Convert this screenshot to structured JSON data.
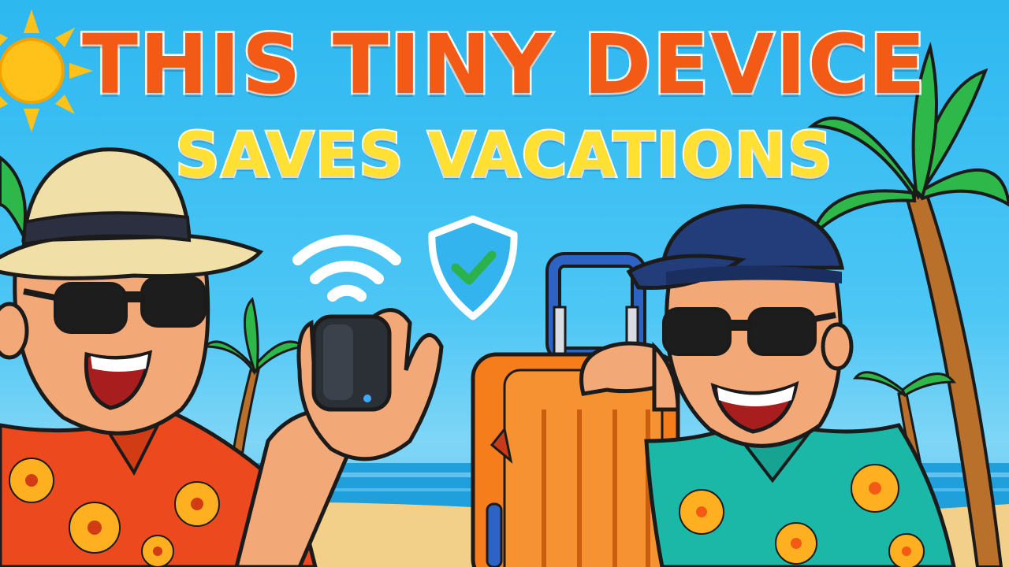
{
  "headline": {
    "line1": "THIS TINY DEVICE",
    "line2": "SAVES VACATIONS"
  },
  "colors": {
    "line1": "#f35a16",
    "line2": "#ffe033",
    "sky": "#2db8f0",
    "sun": "#ffc21a",
    "palm_leaf": "#2fb84a",
    "palm_trunk": "#b8702a",
    "sea": "#1f9fdc",
    "sand": "#f3d08a",
    "skin": "#f2a877",
    "left_shirt": "#ec4a1e",
    "right_shirt": "#1bb8a8",
    "hibiscus": "#ffb020",
    "fedora": "#f1dfa8",
    "cap": "#233d7a",
    "sunglasses": "#1d1d1d",
    "suitcase": "#f57d1c",
    "shield_check": "#2bb24c",
    "device": "#2b2f36",
    "device_led": "#3fa9ff",
    "wifi": "#ffffff"
  },
  "icons": {
    "wifi": "wifi-icon",
    "shield": "shield-check-icon",
    "sun": "sun-icon"
  }
}
